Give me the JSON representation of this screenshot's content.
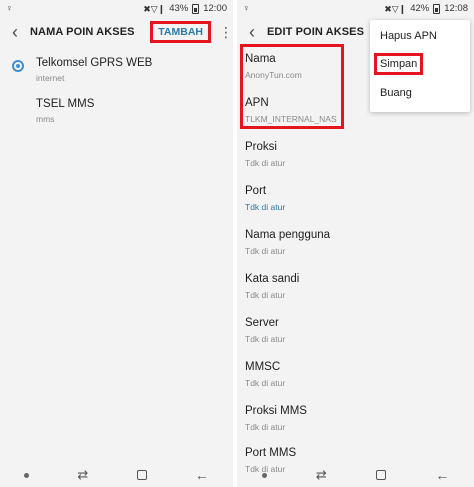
{
  "left": {
    "status": {
      "left_icon": "♀",
      "signal_icons": "✖▽❙",
      "battery_pct": "43%",
      "time": "12:00"
    },
    "title": "NAMA POIN AKSES",
    "add_label": "TAMBAH",
    "apns": [
      {
        "name": "Telkomsel GPRS WEB",
        "sub": "internet",
        "selected": true
      },
      {
        "name": "TSEL MMS",
        "sub": "mms",
        "selected": false
      }
    ]
  },
  "right": {
    "status": {
      "left_icon": "♀",
      "signal_icons": "✖▽❙",
      "battery_pct": "42%",
      "time": "12:08"
    },
    "title": "EDIT POIN AKSES",
    "fields": [
      {
        "label": "Nama",
        "value": "AnonyTun.com"
      },
      {
        "label": "APN",
        "value": "TLKM_INTERNAL_NAS"
      },
      {
        "label": "Proksi",
        "value": "Tdk di atur"
      },
      {
        "label": "Port",
        "value": "Tdk di atur"
      },
      {
        "label": "Nama pengguna",
        "value": "Tdk di atur"
      },
      {
        "label": "Kata sandi",
        "value": "Tdk di atur"
      },
      {
        "label": "Server",
        "value": "Tdk di atur"
      },
      {
        "label": "MMSC",
        "value": "Tdk di atur"
      },
      {
        "label": "Proksi MMS",
        "value": "Tdk di atur"
      },
      {
        "label": "Port MMS",
        "value": "Tdk di atur"
      }
    ],
    "menu": [
      "Hapus APN",
      "Simpan",
      "Buang"
    ]
  },
  "colors": {
    "accent": "#2a7aa6",
    "radio": "#3d8fd1",
    "highlight": "#e6141f"
  }
}
